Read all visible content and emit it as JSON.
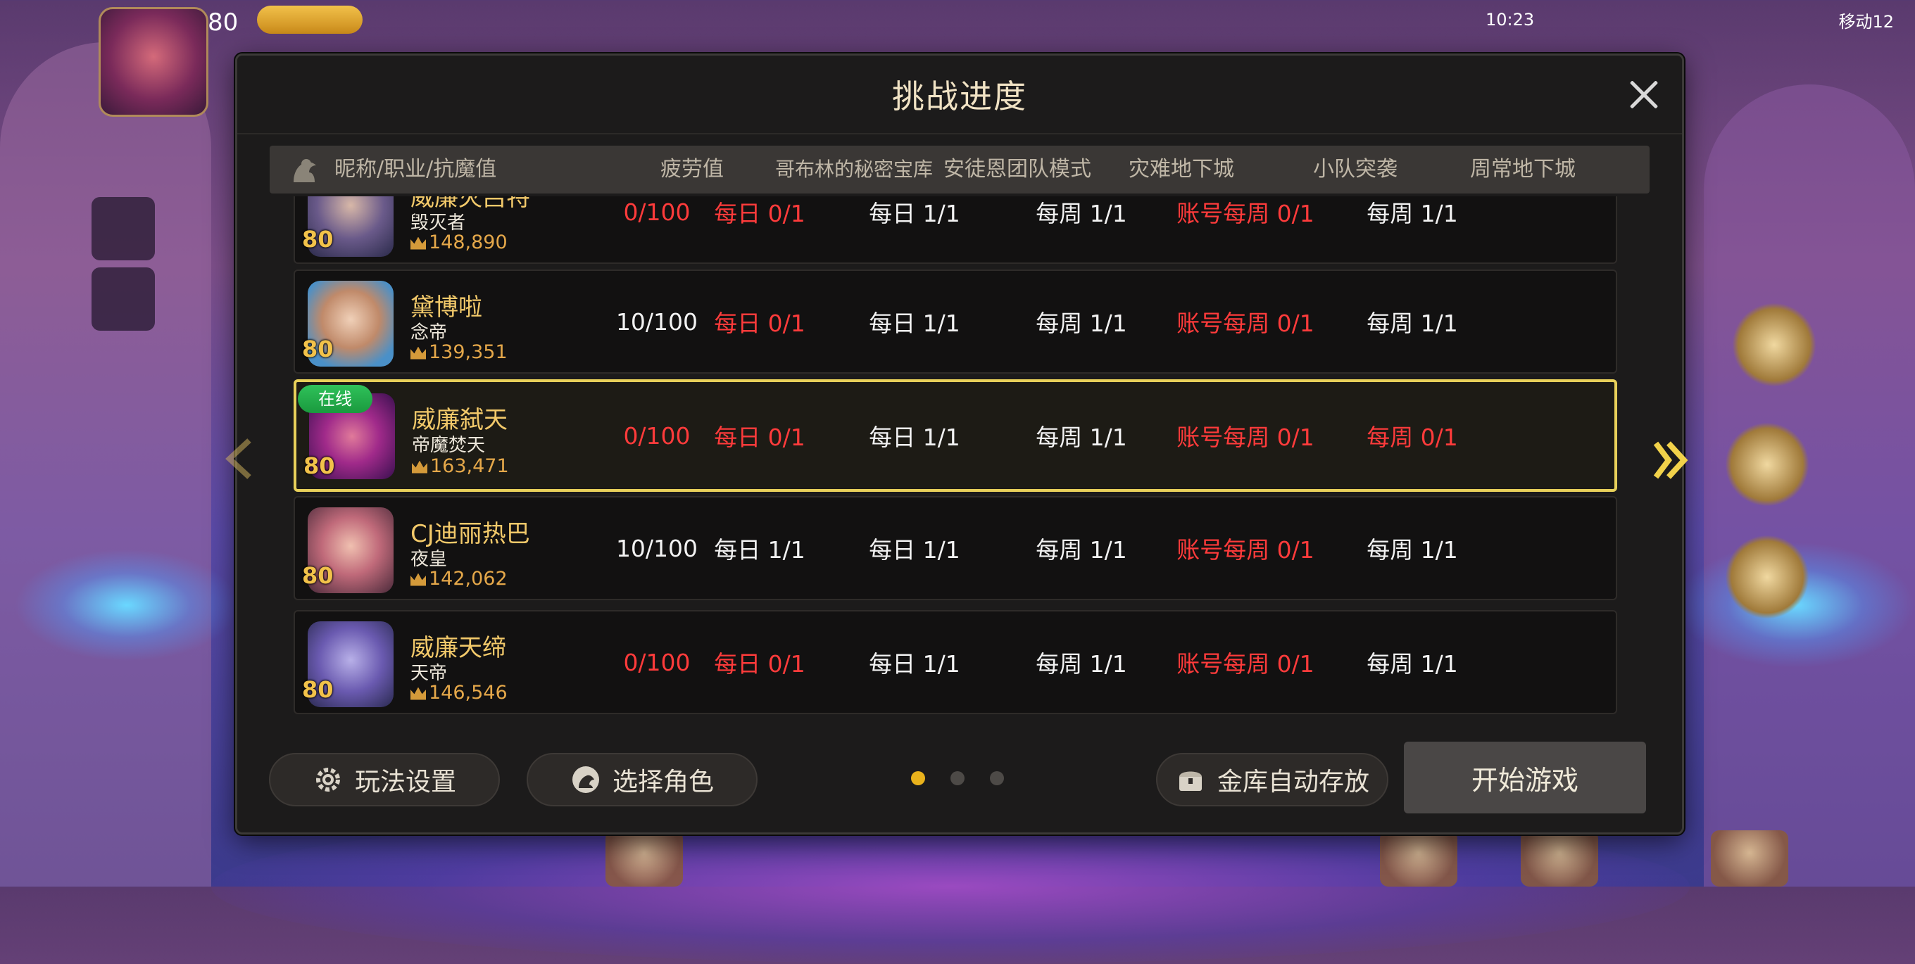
{
  "status": {
    "time": "10:23",
    "carrier": "移动12"
  },
  "player_top": {
    "level": "80"
  },
  "dialog": {
    "title": "挑战进度",
    "headers": [
      "昵称/职业/抗魔值",
      "疲劳值",
      "哥布林的秘密宝库",
      "安徒恩团队模式",
      "灾难地下城",
      "小队突袭",
      "周常地下城"
    ],
    "online_label": "在线",
    "rows": [
      {
        "name": "威廉灭吕特",
        "class": "毁灭者",
        "level": "80",
        "power": "148,890",
        "selected": false,
        "fatigue": "0/100",
        "fatigue_red": true,
        "goblin": "每日 0/1",
        "goblin_red": true,
        "anton": "每日 1/1",
        "anton_red": false,
        "disaster": "每周 1/1",
        "disaster_red": false,
        "squad": "账号每周 0/1",
        "squad_red": true,
        "weekly": "每周 1/1",
        "weekly_red": false
      },
      {
        "name": "黛博啦",
        "class": "念帝",
        "level": "80",
        "power": "139,351",
        "selected": false,
        "fatigue": "10/100",
        "fatigue_red": false,
        "goblin": "每日 0/1",
        "goblin_red": true,
        "anton": "每日 1/1",
        "anton_red": false,
        "disaster": "每周 1/1",
        "disaster_red": false,
        "squad": "账号每周 0/1",
        "squad_red": true,
        "weekly": "每周 1/1",
        "weekly_red": false
      },
      {
        "name": "威廉弑天",
        "class": "帝魔焚天",
        "level": "80",
        "power": "163,471",
        "selected": true,
        "online": true,
        "fatigue": "0/100",
        "fatigue_red": true,
        "goblin": "每日 0/1",
        "goblin_red": true,
        "anton": "每日 1/1",
        "anton_red": false,
        "disaster": "每周 1/1",
        "disaster_red": false,
        "squad": "账号每周 0/1",
        "squad_red": true,
        "weekly": "每周 0/1",
        "weekly_red": true
      },
      {
        "name": "CJ迪丽热巴",
        "class": "夜皇",
        "level": "80",
        "power": "142,062",
        "selected": false,
        "fatigue": "10/100",
        "fatigue_red": false,
        "goblin": "每日 1/1",
        "goblin_red": false,
        "anton": "每日 1/1",
        "anton_red": false,
        "disaster": "每周 1/1",
        "disaster_red": false,
        "squad": "账号每周 0/1",
        "squad_red": true,
        "weekly": "每周 1/1",
        "weekly_red": false
      },
      {
        "name": "威廉天缔",
        "class": "天帝",
        "level": "80",
        "power": "146,546",
        "selected": false,
        "fatigue": "0/100",
        "fatigue_red": true,
        "goblin": "每日 0/1",
        "goblin_red": true,
        "anton": "每日 1/1",
        "anton_red": false,
        "disaster": "每周 1/1",
        "disaster_red": false,
        "squad": "账号每周 0/1",
        "squad_red": true,
        "weekly": "每周 1/1",
        "weekly_red": false
      }
    ],
    "footer": {
      "settings_label": "玩法设置",
      "select_role_label": "选择角色",
      "vault_label": "金库自动存放",
      "start_label": "开始游戏",
      "page_count": 3,
      "active_page": 0
    }
  },
  "colors": {
    "red": "#ff3b3b",
    "gold": "#f2c96a",
    "selected_border": "#e8d05a",
    "online": "#2fc25a"
  }
}
